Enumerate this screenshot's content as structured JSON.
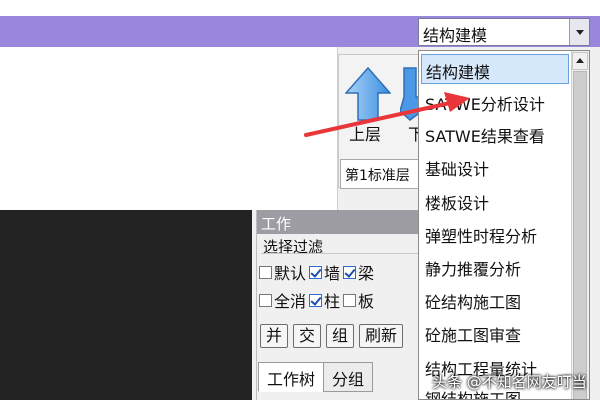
{
  "module_select": {
    "value": "结构建模"
  },
  "dropdown": {
    "items": [
      "结构建模",
      "SATWE分析设计",
      "SATWE结果查看",
      "基础设计",
      "楼板设计",
      "弹塑性时程分析",
      "静力推覆分析",
      "砼结构施工图",
      "砼施工图审查",
      "结构工程量统计",
      "钢结构施工图"
    ],
    "selected_index": 0
  },
  "floor_panel": {
    "up_label": "上层",
    "down_label": "下",
    "floor_value": "第1标准层"
  },
  "work_panel": {
    "title": "工作",
    "filter_title": "选择过滤",
    "row1": [
      {
        "label": "默认",
        "checked": false
      },
      {
        "label": "墙",
        "checked": true
      },
      {
        "label": "梁",
        "checked": true
      }
    ],
    "row2": [
      {
        "label": "全消",
        "checked": false
      },
      {
        "label": "柱",
        "checked": true
      },
      {
        "label": "板",
        "checked": false
      }
    ],
    "buttons": [
      "并",
      "交",
      "组",
      "刷新"
    ],
    "tabs": [
      "工作树",
      "分组"
    ]
  },
  "watermark": "头条 @不知名网友叮当",
  "colors": {
    "top_bar": "#9b86de",
    "arrow": "#e8363a",
    "selection": "#d6e8fb"
  }
}
